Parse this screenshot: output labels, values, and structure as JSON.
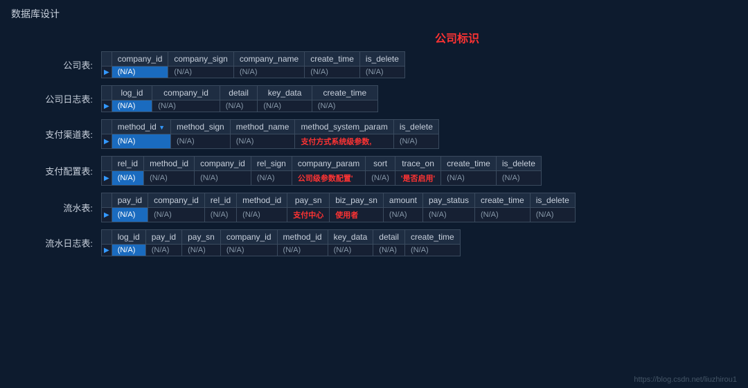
{
  "page": {
    "title": "数据库设计",
    "centerLabel": "公司标识",
    "footer": "https://blog.csdn.net/liuzhirou1"
  },
  "tables": [
    {
      "label": "公司表:",
      "columns": [
        "company_id",
        "company_sign",
        "company_name",
        "create_time",
        "is_delete"
      ],
      "row": [
        "(N/A)",
        "(N/A)",
        "(N/A)",
        "(N/A)",
        "(N/A)"
      ],
      "blueCol": 0
    },
    {
      "label": "公司日志表:",
      "columns": [
        "log_id",
        "company_id",
        "detail",
        "key_data",
        "create_time"
      ],
      "row": [
        "(N/A)",
        "(N/A)",
        "(N/A)",
        "(N/A)",
        "(N/A)"
      ],
      "blueCol": 0
    },
    {
      "label": "支付渠道表:",
      "columns": [
        "method_id",
        "method_sign",
        "method_name",
        "method_system_param",
        "is_delete"
      ],
      "row": [
        "(N/A)",
        "(N/A)",
        "(N/A)",
        "支付方式系统级参数,",
        "(N/A)"
      ],
      "blueCol": 0,
      "hasDropdown": true,
      "redCol": 3
    },
    {
      "label": "支付配置表:",
      "columns": [
        "rel_id",
        "method_id",
        "company_id",
        "rel_sign",
        "company_param",
        "sort",
        "trace_on",
        "create_time",
        "is_delete"
      ],
      "row": [
        "(N/A)",
        "(N/A)",
        "(N/A)",
        "(N/A)",
        "公司级参数配置'",
        "(N/A)",
        "'是否启用'",
        "(N/A)",
        "(N/A)"
      ],
      "blueCol": 0,
      "redCol": 4,
      "redCol2": 6
    },
    {
      "label": "流水表:",
      "columns": [
        "pay_id",
        "company_id",
        "rel_id",
        "method_id",
        "pay_sn",
        "biz_pay_sn",
        "amount",
        "pay_status",
        "create_time",
        "is_delete"
      ],
      "row": [
        "(N/A)",
        "(N/A)",
        "(N/A)",
        "(N/A)",
        "支付中心",
        "使用者",
        "(N/A)",
        "(N/A)",
        "(N/A)",
        "(N/A)"
      ],
      "blueCol": 0,
      "redCol": 4,
      "redCol2": 5
    },
    {
      "label": "流水日志表:",
      "columns": [
        "log_id",
        "pay_id",
        "pay_sn",
        "company_id",
        "method_id",
        "key_data",
        "detail",
        "create_time"
      ],
      "row": [
        "(N/A)",
        "(N/A)",
        "(N/A)",
        "(N/A)",
        "(N/A)",
        "(N/A)",
        "(N/A)",
        "(N/A)"
      ],
      "blueCol": 0
    }
  ]
}
